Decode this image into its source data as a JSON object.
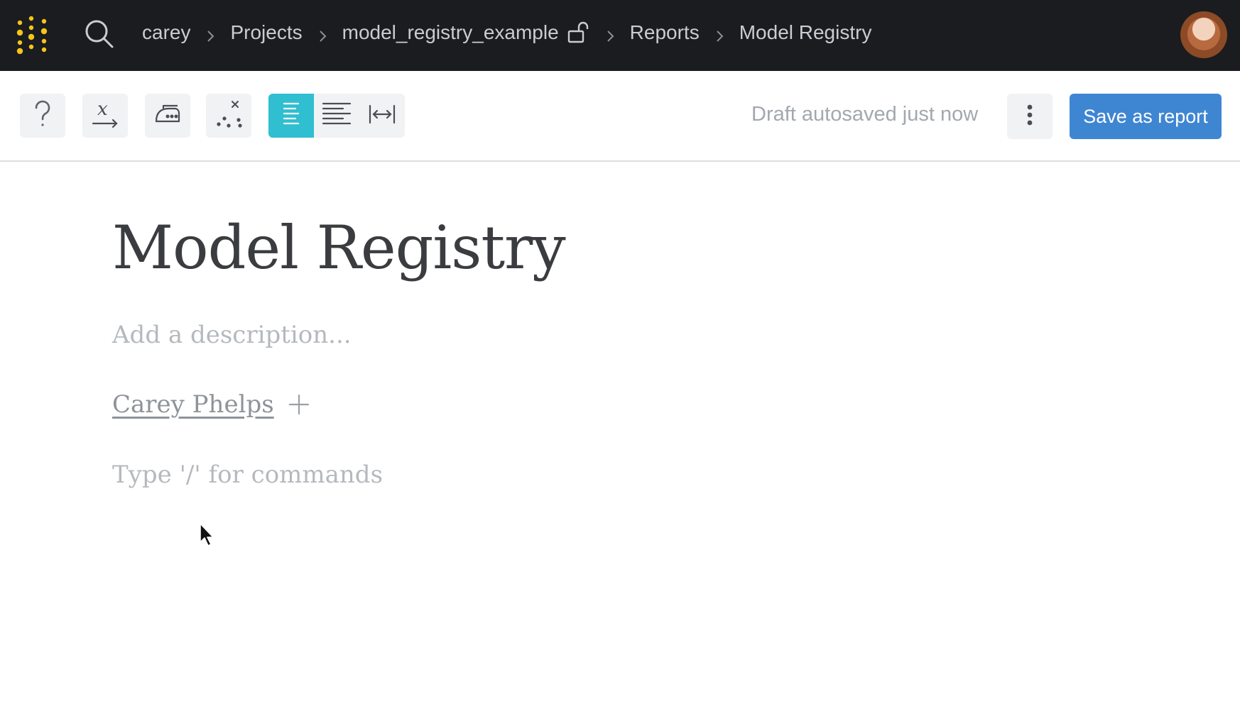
{
  "nav": {
    "logo_icon": "dots-logo-icon",
    "search_icon": "search-icon",
    "breadcrumbs": [
      {
        "label": "carey"
      },
      {
        "label": "Projects"
      },
      {
        "label": "model_registry_example"
      },
      {
        "label": "Reports"
      },
      {
        "label": "Model Registry"
      }
    ],
    "separator_icon": "chevron-right-icon",
    "project_lock_icon": "unlock-icon",
    "avatar_icon": "user-avatar"
  },
  "toolbar": {
    "help_icon": "help-icon",
    "variable_icon": "variable-x-icon",
    "iron_icon": "iron-icon",
    "scatter_icon": "scatter-plot-icon",
    "width_options": [
      {
        "icon": "align-narrow-icon",
        "active": true
      },
      {
        "icon": "align-wide-icon",
        "active": false
      },
      {
        "icon": "full-width-icon",
        "active": false
      }
    ],
    "autosave_text": "Draft autosaved just now",
    "more_icon": "vertical-dots-icon",
    "save_label": "Save as report"
  },
  "report": {
    "title": "Model Registry",
    "description_placeholder": "Add a description...",
    "author": "Carey Phelps",
    "add_author_icon": "plus-icon",
    "command_hint": "Type '/' for commands"
  },
  "colors": {
    "topbar_bg": "#1a1c1f",
    "logo_yellow": "#f5c518",
    "accent_teal": "#2fbfd0",
    "save_blue": "#3f86d2"
  }
}
